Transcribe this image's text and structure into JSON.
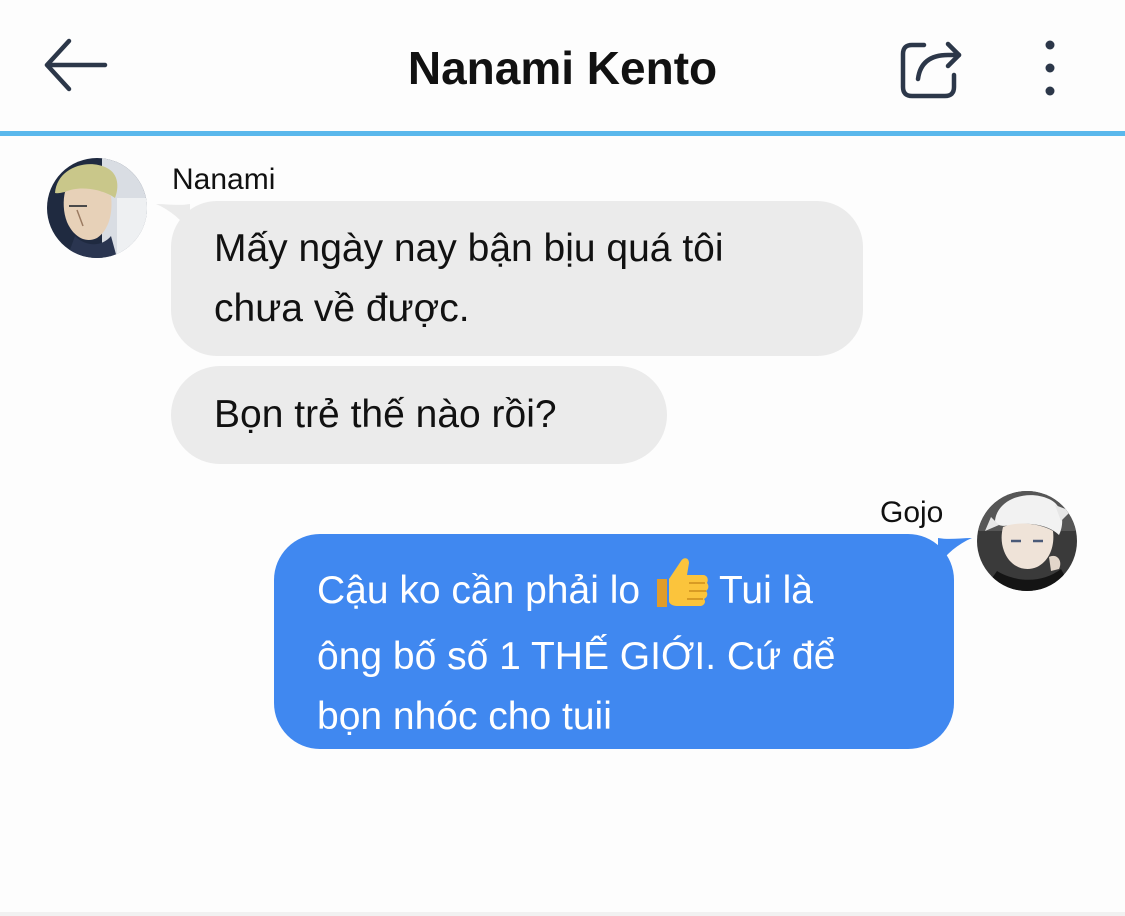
{
  "header": {
    "title": "Nanami Kento",
    "back_icon": "arrow-left-icon",
    "share_icon": "share-icon",
    "more_icon": "more-vertical-icon",
    "accent_color": "#5ab8ec"
  },
  "messages": [
    {
      "sender": "Nanami",
      "direction": "incoming",
      "avatar_icon": "nanami-avatar",
      "lines": [
        "Mấy ngày nay bận bịu quá tôi",
        "chưa về được."
      ]
    },
    {
      "sender": "Nanami",
      "direction": "incoming",
      "lines": [
        "Bọn trẻ thế nào rồi?"
      ]
    },
    {
      "sender": "Gojo",
      "direction": "outgoing",
      "avatar_icon": "gojo-avatar",
      "line1_part1": "Cậu ko cần phải lo",
      "line1_emoji": "thumbs-up-icon",
      "line1_part2": "Tui là",
      "line2": "ông bố số 1 THẾ GIỚI. Cứ để",
      "line3": "bọn nhóc cho tuii"
    }
  ],
  "colors": {
    "incoming_bubble": "#ebebeb",
    "outgoing_bubble": "#4088f0",
    "outgoing_text": "#ffffff"
  }
}
